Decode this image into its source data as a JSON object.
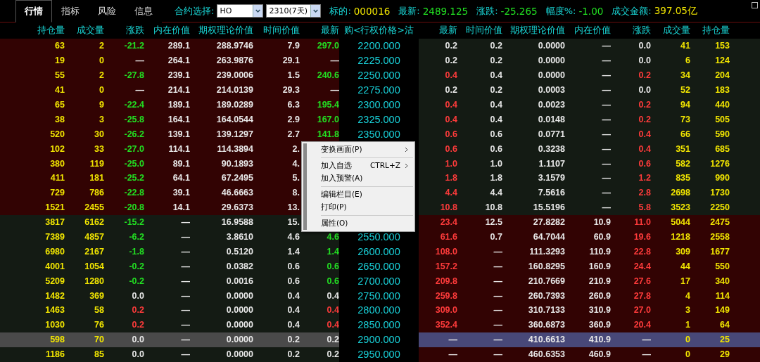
{
  "tabs": [
    {
      "label": "行情",
      "selected": true
    },
    {
      "label": "指标",
      "selected": false
    },
    {
      "label": "风险",
      "selected": false
    },
    {
      "label": "信息",
      "selected": false
    }
  ],
  "contract": {
    "label": "合约选择:",
    "product": "HO",
    "month": "2310(7天)"
  },
  "quote": [
    {
      "label": "标的:",
      "value": "000016",
      "color": "#f2e600"
    },
    {
      "label": "最新:",
      "value": "2489.125",
      "color": "#22e022"
    },
    {
      "label": "涨跌:",
      "value": "-25.265",
      "color": "#22e022"
    },
    {
      "label": "幅度%:",
      "value": "-1.00",
      "color": "#22e022"
    },
    {
      "label": "成交金额:",
      "value": "397.05亿",
      "color": "#f2e600"
    }
  ],
  "columns": {
    "call": [
      "持仓量",
      "成交量",
      "涨跌",
      "内在价值",
      "期权理论价值",
      "时间价值",
      "最新"
    ],
    "strike": "购<行权价格>沽",
    "put": [
      "最新",
      "时间价值",
      "期权理论价值",
      "内在价值",
      "涨跌",
      "成交量",
      "持仓量"
    ]
  },
  "rows": [
    {
      "call": [
        "63",
        "2",
        {
          "text": "-21.2",
          "color": "#22e022"
        },
        "289.1",
        "288.9746",
        "7.9",
        {
          "text": "297.0",
          "color": "#22e022"
        }
      ],
      "call_itm": true,
      "strike": "2200.000",
      "put": [
        {
          "text": "0.2",
          "color": "#e8e8e8"
        },
        "0.2",
        "0.0000",
        "—",
        {
          "text": "0.0",
          "color": "#e8e8e8"
        },
        "41",
        "153"
      ],
      "put_itm": false,
      "selected": false
    },
    {
      "call": [
        "19",
        "0",
        {
          "text": "—",
          "color": "#e8e8e8"
        },
        "264.1",
        "263.9876",
        "29.1",
        {
          "text": "—",
          "color": "#e8e8e8"
        }
      ],
      "call_itm": true,
      "strike": "2225.000",
      "put": [
        {
          "text": "0.2",
          "color": "#e8e8e8"
        },
        "0.2",
        "0.0000",
        "—",
        {
          "text": "0.0",
          "color": "#e8e8e8"
        },
        "6",
        "124"
      ],
      "put_itm": false,
      "selected": false
    },
    {
      "call": [
        "55",
        "2",
        {
          "text": "-27.8",
          "color": "#22e022"
        },
        "239.1",
        "239.0006",
        "1.5",
        {
          "text": "240.6",
          "color": "#22e022"
        }
      ],
      "call_itm": true,
      "strike": "2250.000",
      "put": [
        {
          "text": "0.4",
          "color": "#ff3b3b"
        },
        "0.4",
        "0.0000",
        "—",
        {
          "text": "0.2",
          "color": "#ff3b3b"
        },
        "34",
        "204"
      ],
      "put_itm": false,
      "selected": false
    },
    {
      "call": [
        "41",
        "0",
        {
          "text": "—",
          "color": "#e8e8e8"
        },
        "214.1",
        "214.0139",
        "29.3",
        {
          "text": "—",
          "color": "#e8e8e8"
        }
      ],
      "call_itm": true,
      "strike": "2275.000",
      "put": [
        {
          "text": "0.2",
          "color": "#e8e8e8"
        },
        "0.2",
        "0.0003",
        "—",
        {
          "text": "0.0",
          "color": "#e8e8e8"
        },
        "52",
        "183"
      ],
      "put_itm": false,
      "selected": false
    },
    {
      "call": [
        "65",
        "9",
        {
          "text": "-22.4",
          "color": "#22e022"
        },
        "189.1",
        "189.0289",
        "6.3",
        {
          "text": "195.4",
          "color": "#22e022"
        }
      ],
      "call_itm": true,
      "strike": "2300.000",
      "put": [
        {
          "text": "0.4",
          "color": "#ff3b3b"
        },
        "0.4",
        "0.0023",
        "—",
        {
          "text": "0.2",
          "color": "#ff3b3b"
        },
        "94",
        "440"
      ],
      "put_itm": false,
      "selected": false
    },
    {
      "call": [
        "38",
        "3",
        {
          "text": "-25.8",
          "color": "#22e022"
        },
        "164.1",
        "164.0544",
        "2.9",
        {
          "text": "167.0",
          "color": "#22e022"
        }
      ],
      "call_itm": true,
      "strike": "2325.000",
      "put": [
        {
          "text": "0.4",
          "color": "#ff3b3b"
        },
        "0.4",
        "0.0148",
        "—",
        {
          "text": "0.2",
          "color": "#ff3b3b"
        },
        "73",
        "505"
      ],
      "put_itm": false,
      "selected": false
    },
    {
      "call": [
        "520",
        "30",
        {
          "text": "-26.2",
          "color": "#22e022"
        },
        "139.1",
        "139.1297",
        "2.7",
        {
          "text": "141.8",
          "color": "#22e022"
        }
      ],
      "call_itm": true,
      "strike": "2350.000",
      "put": [
        {
          "text": "0.6",
          "color": "#ff3b3b"
        },
        "0.6",
        "0.0771",
        "—",
        {
          "text": "0.4",
          "color": "#ff3b3b"
        },
        "66",
        "590"
      ],
      "put_itm": false,
      "selected": false
    },
    {
      "call": [
        "102",
        "33",
        {
          "text": "-27.0",
          "color": "#22e022"
        },
        "114.1",
        "114.3894",
        "2."
      ],
      "call_itm": true,
      "put": [
        {
          "text": "0.6",
          "color": "#ff3b3b"
        },
        "0.6",
        "0.3238",
        "—",
        {
          "text": "0.4",
          "color": "#ff3b3b"
        },
        "351",
        "685"
      ],
      "put_itm": false,
      "selected": false
    },
    {
      "call": [
        "380",
        "119",
        {
          "text": "-25.0",
          "color": "#22e022"
        },
        "89.1",
        "90.1893",
        "4."
      ],
      "call_itm": true,
      "put": [
        {
          "text": "1.0",
          "color": "#ff3b3b"
        },
        "1.0",
        "1.1107",
        "—",
        {
          "text": "0.6",
          "color": "#ff3b3b"
        },
        "582",
        "1276"
      ],
      "put_itm": false,
      "selected": false
    },
    {
      "call": [
        "411",
        "181",
        {
          "text": "-25.2",
          "color": "#22e022"
        },
        "64.1",
        "67.2495",
        "5."
      ],
      "call_itm": true,
      "put": [
        {
          "text": "1.8",
          "color": "#ff3b3b"
        },
        "1.8",
        "3.1579",
        "—",
        {
          "text": "1.2",
          "color": "#ff3b3b"
        },
        "835",
        "990"
      ],
      "put_itm": false,
      "selected": false
    },
    {
      "call": [
        "729",
        "786",
        {
          "text": "-22.8",
          "color": "#22e022"
        },
        "39.1",
        "46.6663",
        "8."
      ],
      "call_itm": true,
      "put": [
        {
          "text": "4.4",
          "color": "#ff3b3b"
        },
        "4.4",
        "7.5616",
        "—",
        {
          "text": "2.8",
          "color": "#ff3b3b"
        },
        "2698",
        "1730"
      ],
      "put_itm": false,
      "selected": false
    },
    {
      "call": [
        "1521",
        "2455",
        {
          "text": "-20.8",
          "color": "#22e022"
        },
        "14.1",
        "29.6373",
        "13."
      ],
      "call_itm": true,
      "put": [
        {
          "text": "10.8",
          "color": "#ff3b3b"
        },
        "10.8",
        "15.5196",
        "—",
        {
          "text": "5.8",
          "color": "#ff3b3b"
        },
        "3523",
        "2250"
      ],
      "put_itm": false,
      "selected": false
    },
    {
      "call": [
        "3817",
        "6162",
        {
          "text": "-15.2",
          "color": "#22e022"
        },
        "—",
        "16.9588",
        "15."
      ],
      "call_itm": false,
      "put": [
        {
          "text": "23.4",
          "color": "#ff3b3b"
        },
        "12.5",
        "27.8282",
        "10.9",
        {
          "text": "11.0",
          "color": "#ff3b3b"
        },
        "5044",
        "2475"
      ],
      "put_itm": true,
      "selected": false
    },
    {
      "call": [
        "7389",
        "4857",
        {
          "text": "-6.2",
          "color": "#22e022"
        },
        "—",
        "3.8610",
        "4.6",
        {
          "text": "4.6",
          "color": "#22e022"
        }
      ],
      "call_itm": false,
      "strike": "2550.000",
      "put": [
        {
          "text": "61.6",
          "color": "#ff3b3b"
        },
        "0.7",
        "64.7044",
        "60.9",
        {
          "text": "19.6",
          "color": "#ff3b3b"
        },
        "1218",
        "2558"
      ],
      "put_itm": true,
      "selected": false
    },
    {
      "call": [
        "6980",
        "2167",
        {
          "text": "-1.8",
          "color": "#22e022"
        },
        "—",
        "0.5120",
        "1.4",
        {
          "text": "1.4",
          "color": "#22e022"
        }
      ],
      "call_itm": false,
      "strike": "2600.000",
      "put": [
        {
          "text": "108.0",
          "color": "#ff3b3b"
        },
        "—",
        "111.3293",
        "110.9",
        {
          "text": "22.8",
          "color": "#ff3b3b"
        },
        "309",
        "1677"
      ],
      "put_itm": true,
      "selected": false
    },
    {
      "call": [
        "4001",
        "1054",
        {
          "text": "-0.2",
          "color": "#22e022"
        },
        "—",
        "0.0382",
        "0.6",
        {
          "text": "0.6",
          "color": "#22e022"
        }
      ],
      "call_itm": false,
      "strike": "2650.000",
      "put": [
        {
          "text": "157.2",
          "color": "#ff3b3b"
        },
        "—",
        "160.8295",
        "160.9",
        {
          "text": "24.4",
          "color": "#ff3b3b"
        },
        "44",
        "550"
      ],
      "put_itm": true,
      "selected": false
    },
    {
      "call": [
        "5209",
        "1280",
        {
          "text": "-0.2",
          "color": "#22e022"
        },
        "—",
        "0.0016",
        "0.6",
        {
          "text": "0.6",
          "color": "#22e022"
        }
      ],
      "call_itm": false,
      "strike": "2700.000",
      "put": [
        {
          "text": "209.8",
          "color": "#ff3b3b"
        },
        "—",
        "210.7669",
        "210.9",
        {
          "text": "27.6",
          "color": "#ff3b3b"
        },
        "17",
        "340"
      ],
      "put_itm": true,
      "selected": false
    },
    {
      "call": [
        "1482",
        "369",
        {
          "text": "0.0",
          "color": "#e8e8e8"
        },
        "—",
        "0.0000",
        "0.4",
        {
          "text": "0.4",
          "color": "#e8e8e8"
        }
      ],
      "call_itm": false,
      "strike": "2750.000",
      "put": [
        {
          "text": "259.8",
          "color": "#ff3b3b"
        },
        "—",
        "260.7393",
        "260.9",
        {
          "text": "27.8",
          "color": "#ff3b3b"
        },
        "4",
        "114"
      ],
      "put_itm": true,
      "selected": false
    },
    {
      "call": [
        "1463",
        "58",
        {
          "text": "0.2",
          "color": "#ff3b3b"
        },
        "—",
        "0.0000",
        "0.4",
        {
          "text": "0.4",
          "color": "#ff3b3b"
        }
      ],
      "call_itm": false,
      "strike": "2800.000",
      "put": [
        {
          "text": "309.0",
          "color": "#ff3b3b"
        },
        "—",
        "310.7133",
        "310.9",
        {
          "text": "27.0",
          "color": "#ff3b3b"
        },
        "3",
        "149"
      ],
      "put_itm": true,
      "selected": false
    },
    {
      "call": [
        "1030",
        "76",
        {
          "text": "0.2",
          "color": "#ff3b3b"
        },
        "—",
        "0.0000",
        "0.4",
        {
          "text": "0.4",
          "color": "#ff3b3b"
        }
      ],
      "call_itm": false,
      "strike": "2850.000",
      "put": [
        {
          "text": "352.4",
          "color": "#ff3b3b"
        },
        "—",
        "360.6873",
        "360.9",
        {
          "text": "20.4",
          "color": "#ff3b3b"
        },
        "1",
        "64"
      ],
      "put_itm": true,
      "selected": false
    },
    {
      "call": [
        "598",
        "70",
        {
          "text": "0.0",
          "color": "#e8e8e8"
        },
        "—",
        "0.0000",
        "0.2",
        {
          "text": "0.2",
          "color": "#e8e8e8"
        }
      ],
      "call_itm": false,
      "strike": "2900.000",
      "put": [
        {
          "text": "—",
          "color": "#e8e8e8"
        },
        "—",
        "410.6613",
        "410.9",
        {
          "text": "—",
          "color": "#e8e8e8"
        },
        "0",
        "25"
      ],
      "put_itm": true,
      "selected": true
    },
    {
      "call": [
        "1186",
        "85",
        {
          "text": "0.0",
          "color": "#e8e8e8"
        },
        "—",
        "0.0000",
        "0.2",
        {
          "text": "0.2",
          "color": "#e8e8e8"
        }
      ],
      "call_itm": false,
      "strike": "2950.000",
      "put": [
        {
          "text": "—",
          "color": "#e8e8e8"
        },
        "—",
        "460.6353",
        "460.9",
        {
          "text": "—",
          "color": "#e8e8e8"
        },
        "0",
        "29"
      ],
      "put_itm": true,
      "selected": false
    }
  ],
  "context_menu": [
    {
      "label": "变换画面(P)",
      "submenu": true,
      "separator_after": true
    },
    {
      "label": "加入自选",
      "shortcut": "CTRL+Z",
      "submenu": true,
      "separator_after": false
    },
    {
      "label": "加入预警(A)",
      "submenu": false,
      "separator_after": true
    },
    {
      "label": "编辑栏目(E)",
      "submenu": false,
      "separator_after": false
    },
    {
      "label": "打印(P)",
      "submenu": false,
      "separator_after": true
    },
    {
      "label": "属性(O)",
      "submenu": false,
      "separator_after": false
    }
  ]
}
